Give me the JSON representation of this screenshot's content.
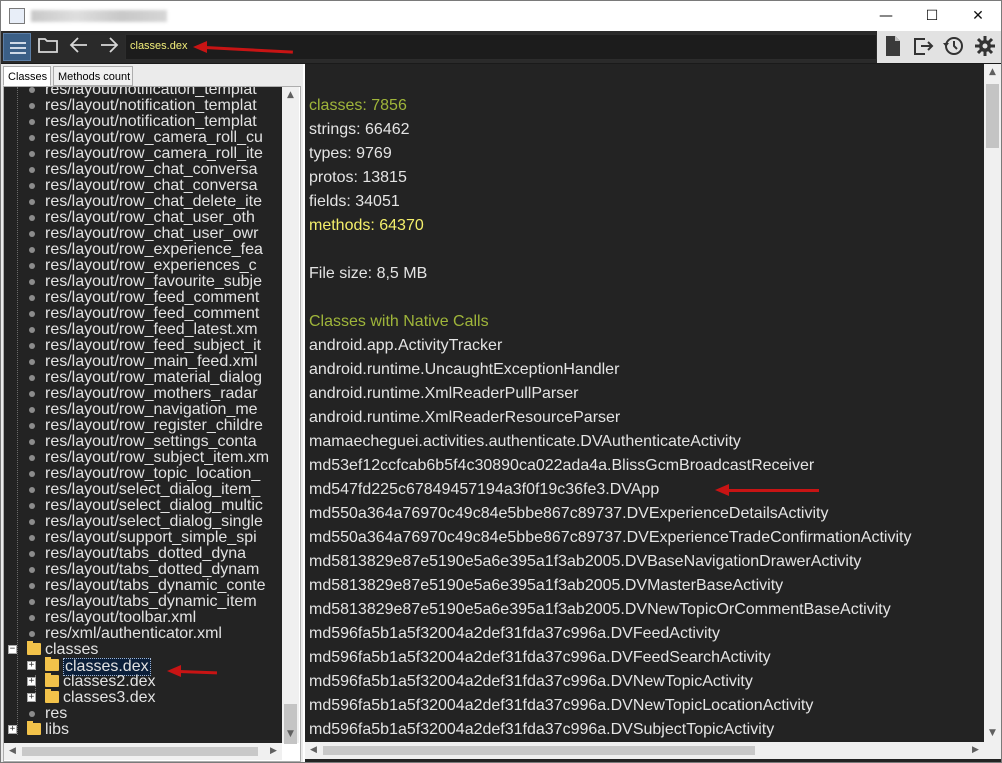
{
  "window": {
    "controls": {
      "minimize": "—",
      "maximize": "☐",
      "close": "✕"
    }
  },
  "toolbar": {
    "path_value": "classes.dex",
    "icons": [
      "menu-icon",
      "open-folder-icon",
      "back-arrow-icon",
      "forward-arrow-icon",
      "document-icon",
      "export-icon",
      "history-icon",
      "settings-gear-icon"
    ]
  },
  "left_panel": {
    "tabs": [
      "Classes",
      "Methods count"
    ],
    "tree": [
      "res/layout/notification_templat",
      "res/layout/notification_templat",
      "res/layout/notification_templat",
      "res/layout/row_camera_roll_cu",
      "res/layout/row_camera_roll_ite",
      "res/layout/row_chat_conversa",
      "res/layout/row_chat_conversa",
      "res/layout/row_chat_delete_ite",
      "res/layout/row_chat_user_oth",
      "res/layout/row_chat_user_owr",
      "res/layout/row_experience_fea",
      "res/layout/row_experiences_c",
      "res/layout/row_favourite_subje",
      "res/layout/row_feed_comment",
      "res/layout/row_feed_comment",
      "res/layout/row_feed_latest.xm",
      "res/layout/row_feed_subject_it",
      "res/layout/row_main_feed.xml",
      "res/layout/row_material_dialog",
      "res/layout/row_mothers_radar",
      "res/layout/row_navigation_me",
      "res/layout/row_register_childre",
      "res/layout/row_settings_conta",
      "res/layout/row_subject_item.xm",
      "res/layout/row_topic_location_",
      "res/layout/select_dialog_item_",
      "res/layout/select_dialog_multic",
      "res/layout/select_dialog_single",
      "res/layout/support_simple_spi",
      "res/layout/tabs_dotted_dyna",
      "res/layout/tabs_dotted_dynam",
      "res/layout/tabs_dynamic_conte",
      "res/layout/tabs_dynamic_item",
      "res/layout/toolbar.xml",
      "res/xml/authenticator.xml"
    ],
    "classes_folder": "classes",
    "dex_files": [
      "classes.dex",
      "classes2.dex",
      "classes3.dex"
    ],
    "res_folder": "res",
    "libs_folder": "libs"
  },
  "right_panel": {
    "summary": {
      "classes": "classes: 7856",
      "strings": "strings: 66462",
      "types": "types: 9769",
      "protos": "protos: 13815",
      "fields": "fields: 34051",
      "methods": "methods: 64370",
      "file_size": "File size: 8,5 MB"
    },
    "native_calls_heading": "Classes with Native Calls",
    "native_calls": [
      "android.app.ActivityTracker",
      "android.runtime.UncaughtExceptionHandler",
      "android.runtime.XmlReaderPullParser",
      "android.runtime.XmlReaderResourceParser",
      "mamaecheguei.activities.authenticate.DVAuthenticateActivity",
      "md53ef12ccfcab6b5f4c30890ca022ada4a.BlissGcmBroadcastReceiver",
      "md547fd225c67849457194a3f0f19c36fe3.DVApp",
      "md550a364a76970c49c84e5bbe867c89737.DVExperienceDetailsActivity",
      "md550a364a76970c49c84e5bbe867c89737.DVExperienceTradeConfirmationActivity",
      "md5813829e87e5190e5a6e395a1f3ab2005.DVBaseNavigationDrawerActivity",
      "md5813829e87e5190e5a6e395a1f3ab2005.DVMasterBaseActivity",
      "md5813829e87e5190e5a6e395a1f3ab2005.DVNewTopicOrCommentBaseActivity",
      "md596fa5b1a5f32004a2def31fda37c996a.DVFeedActivity",
      "md596fa5b1a5f32004a2def31fda37c996a.DVFeedSearchActivity",
      "md596fa5b1a5f32004a2def31fda37c996a.DVNewTopicActivity",
      "md596fa5b1a5f32004a2def31fda37c996a.DVNewTopicLocationActivity",
      "md596fa5b1a5f32004a2def31fda37c996a.DVSubjectTopicActivity"
    ]
  },
  "colors": {
    "dark_bg": "#232323",
    "green_label": "#9fb53a",
    "yellow_label": "#f4ef6b",
    "annotation_arrow": "#c81414"
  }
}
